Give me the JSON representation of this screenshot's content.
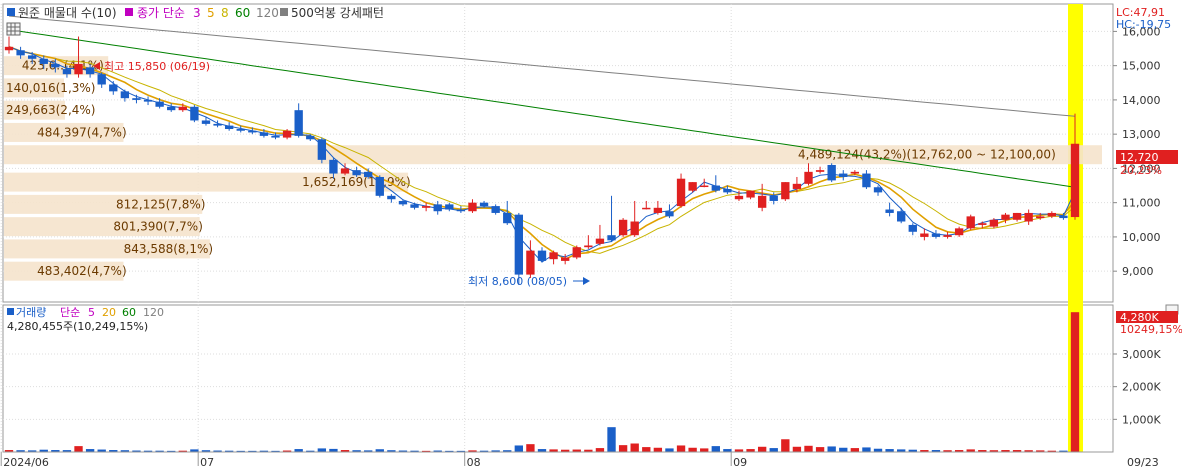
{
  "header": {
    "series_label": "원준 매물대 수(10)",
    "ma_label": "종가 단순",
    "ma_periods": [
      {
        "value": "3",
        "color": "#c000c0"
      },
      {
        "value": "5",
        "color": "#e0a000"
      },
      {
        "value": "8",
        "color": "#c8b400"
      },
      {
        "value": "60",
        "color": "#008000"
      },
      {
        "value": "120",
        "color": "#808080"
      }
    ],
    "extra_label": "500억봉 강세패턴"
  },
  "right_labels": {
    "lc": "LC:47,91",
    "hc": "HC:-19,75",
    "price_badge": "12,720",
    "price_pct": "20,23%",
    "volume_badge": "4,280K",
    "volume_pct": "10249,15%"
  },
  "volume_panel": {
    "title": "거래량",
    "ma_label": "단순",
    "ma_periods": [
      {
        "value": "5",
        "color": "#c000c0"
      },
      {
        "value": "20",
        "color": "#e0a000"
      },
      {
        "value": "60",
        "color": "#008000"
      },
      {
        "value": "120",
        "color": "#808080"
      }
    ],
    "current": "4,280,455주(10,249,15%)"
  },
  "annotations": {
    "high": "최고 15,850 (06/19)",
    "low": "최저 8,600 (08/05)"
  },
  "colors": {
    "up": "#e02020",
    "down": "#1a5fc8",
    "highlight": "#ffff00",
    "profile": "#f5e3cc",
    "grid": "#dddddd"
  },
  "chart_data": {
    "type": "candlestick",
    "price_axis": {
      "range": [
        8100,
        16800
      ],
      "ticks": [
        "9,000",
        "10,000",
        "11,000",
        "12,000",
        "13,000",
        "14,000",
        "15,000",
        "16,000"
      ],
      "tick_values": [
        9000,
        10000,
        11000,
        12000,
        13000,
        14000,
        15000,
        16000
      ]
    },
    "volume_axis": {
      "range": [
        0,
        4500
      ],
      "unit": "K",
      "ticks": [
        "1,000K",
        "2,000K",
        "3,000K"
      ],
      "tick_values": [
        1000,
        2000,
        3000
      ]
    },
    "x_labels": [
      "2024/06",
      "07",
      "08",
      "09",
      "09/23"
    ],
    "volume_profile": [
      {
        "label": "483,402(4,7%)",
        "price": 9000,
        "share": 4.7
      },
      {
        "label": "843,588(8,1%)",
        "price": 9650,
        "share": 8.1
      },
      {
        "label": "801,390(7,7%)",
        "price": 10300,
        "share": 7.7
      },
      {
        "label": "812,125(7,8%)",
        "price": 10950,
        "share": 7.8
      },
      {
        "label": "1,652,169(15,9%)",
        "price": 11600,
        "share": 15.9
      },
      {
        "label": "4,489,124(43,2%)(12,762,00 ~ 12,100,00)",
        "price": 12400,
        "share": 43.2
      },
      {
        "label": "484,397(4,7%)",
        "price": 13050,
        "share": 4.7
      },
      {
        "label": "249,663(2,4%)",
        "price": 13700,
        "share": 2.4
      },
      {
        "label": "140,016(1,3%)",
        "price": 14350,
        "share": 1.3
      },
      {
        "label": "423,6..(4,1%)",
        "price": 15000,
        "share": 4.1
      }
    ],
    "candles": [
      [
        15450,
        15550,
        15850,
        15350,
        60
      ],
      [
        15450,
        15300,
        15550,
        15200,
        55
      ],
      [
        15300,
        15200,
        15400,
        15050,
        50
      ],
      [
        15200,
        15050,
        15300,
        14900,
        70
      ],
      [
        15050,
        14950,
        15200,
        14800,
        60
      ],
      [
        14900,
        14750,
        15000,
        14650,
        58
      ],
      [
        14750,
        15050,
        15850,
        14650,
        180
      ],
      [
        14950,
        14750,
        15050,
        14650,
        90
      ],
      [
        14750,
        14450,
        14800,
        14350,
        75
      ],
      [
        14450,
        14250,
        14550,
        14150,
        60
      ],
      [
        14250,
        14050,
        14300,
        13950,
        55
      ],
      [
        14050,
        14000,
        14150,
        13900,
        45
      ],
      [
        14000,
        13950,
        14100,
        13850,
        40
      ],
      [
        13950,
        13800,
        14050,
        13750,
        40
      ],
      [
        13800,
        13700,
        13900,
        13650,
        35
      ],
      [
        13700,
        13800,
        13900,
        13650,
        40
      ],
      [
        13800,
        13400,
        13850,
        13350,
        80
      ],
      [
        13400,
        13300,
        13500,
        13250,
        55
      ],
      [
        13300,
        13250,
        13400,
        13200,
        45
      ],
      [
        13250,
        13150,
        13350,
        13100,
        40
      ],
      [
        13150,
        13100,
        13250,
        13050,
        35
      ],
      [
        13100,
        13050,
        13200,
        13000,
        35
      ],
      [
        13050,
        12950,
        13150,
        12900,
        40
      ],
      [
        12950,
        12900,
        13050,
        12850,
        35
      ],
      [
        12900,
        13100,
        13150,
        12850,
        45
      ],
      [
        13700,
        12950,
        13900,
        12900,
        90
      ],
      [
        12950,
        12850,
        13000,
        12800,
        40
      ],
      [
        12850,
        12250,
        12900,
        12150,
        110
      ],
      [
        12250,
        11850,
        12300,
        11700,
        95
      ],
      [
        11850,
        12000,
        12150,
        11800,
        60
      ],
      [
        11950,
        11800,
        12050,
        11750,
        55
      ],
      [
        11900,
        11750,
        12000,
        11700,
        50
      ],
      [
        11750,
        11200,
        11800,
        11150,
        85
      ],
      [
        11200,
        11100,
        11250,
        11000,
        55
      ],
      [
        11050,
        10950,
        11100,
        10900,
        45
      ],
      [
        10950,
        10850,
        11000,
        10800,
        40
      ],
      [
        10850,
        10900,
        11000,
        10750,
        35
      ],
      [
        10950,
        10750,
        11050,
        10650,
        45
      ],
      [
        10950,
        10800,
        11000,
        10750,
        35
      ],
      [
        10800,
        10750,
        10900,
        10700,
        35
      ],
      [
        10750,
        11000,
        11100,
        10700,
        50
      ],
      [
        11000,
        10900,
        11050,
        10850,
        40
      ],
      [
        10900,
        10700,
        10950,
        10650,
        50
      ],
      [
        10700,
        10400,
        11050,
        10350,
        55
      ],
      [
        10650,
        8900,
        10700,
        8600,
        200
      ],
      [
        8900,
        9600,
        9900,
        8800,
        240
      ],
      [
        9600,
        9300,
        9700,
        9250,
        90
      ],
      [
        9350,
        9550,
        9600,
        9200,
        80
      ],
      [
        9300,
        9400,
        9500,
        9200,
        70
      ],
      [
        9400,
        9700,
        9750,
        9350,
        75
      ],
      [
        9700,
        9750,
        10050,
        9650,
        70
      ],
      [
        9800,
        9950,
        10350,
        9750,
        120
      ],
      [
        10050,
        9900,
        11200,
        9850,
        760
      ],
      [
        10050,
        10500,
        10550,
        10000,
        210
      ],
      [
        10050,
        10450,
        11050,
        10000,
        260
      ],
      [
        10850,
        10850,
        11050,
        10800,
        150
      ],
      [
        10700,
        10850,
        11050,
        10650,
        130
      ],
      [
        10750,
        10600,
        10950,
        10550,
        110
      ],
      [
        10900,
        11700,
        11850,
        10850,
        200
      ],
      [
        11350,
        11600,
        11600,
        11300,
        130
      ],
      [
        11500,
        11500,
        11700,
        11450,
        110
      ],
      [
        11500,
        11350,
        11800,
        11300,
        180
      ],
      [
        11400,
        11300,
        11500,
        11250,
        90
      ],
      [
        11100,
        11200,
        11350,
        11050,
        80
      ],
      [
        11150,
        11350,
        11350,
        11100,
        90
      ],
      [
        10850,
        11200,
        11550,
        10750,
        160
      ],
      [
        11200,
        11050,
        11300,
        10950,
        120
      ],
      [
        11100,
        11600,
        11600,
        11050,
        390
      ],
      [
        11400,
        11550,
        11750,
        11300,
        160
      ],
      [
        11550,
        11900,
        12150,
        11500,
        190
      ],
      [
        11900,
        11950,
        12050,
        11850,
        150
      ],
      [
        12100,
        11650,
        12150,
        11600,
        170
      ],
      [
        11850,
        11750,
        11950,
        11650,
        130
      ],
      [
        11850,
        11900,
        11950,
        11800,
        120
      ],
      [
        11850,
        11450,
        11950,
        11400,
        140
      ],
      [
        11450,
        11300,
        11500,
        11200,
        100
      ],
      [
        10800,
        10700,
        11000,
        10600,
        90
      ],
      [
        10750,
        10450,
        10850,
        10400,
        80
      ],
      [
        10350,
        10150,
        10400,
        10050,
        70
      ],
      [
        10000,
        10100,
        10250,
        9900,
        60
      ],
      [
        10100,
        10000,
        10200,
        9950,
        60
      ],
      [
        10000,
        10050,
        10150,
        9950,
        55
      ],
      [
        10050,
        10250,
        10300,
        10000,
        60
      ],
      [
        10250,
        10600,
        10650,
        10200,
        80
      ],
      [
        10350,
        10400,
        10450,
        10250,
        60
      ],
      [
        10300,
        10500,
        10550,
        10250,
        55
      ],
      [
        10500,
        10650,
        10700,
        10400,
        60
      ],
      [
        10500,
        10700,
        10700,
        10450,
        60
      ],
      [
        10450,
        10700,
        10800,
        10350,
        55
      ],
      [
        10550,
        10600,
        10700,
        10500,
        50
      ],
      [
        10600,
        10700,
        10750,
        10550,
        40
      ],
      [
        10620,
        10550,
        10700,
        10500,
        42
      ],
      [
        10580,
        12720,
        13600,
        10500,
        4280
      ]
    ]
  }
}
